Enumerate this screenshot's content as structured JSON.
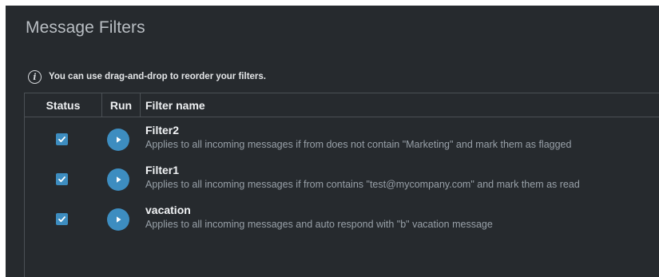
{
  "page": {
    "title": "Message Filters"
  },
  "notice": {
    "text": "You can use drag-and-drop to reorder your filters."
  },
  "table": {
    "columns": {
      "status": "Status",
      "run": "Run",
      "name": "Filter name"
    },
    "rows": [
      {
        "name": "Filter2",
        "description": "Applies to all incoming messages if from does not contain \"Marketing\" and mark them as flagged",
        "enabled": true
      },
      {
        "name": "Filter1",
        "description": "Applies to all incoming messages if from contains \"test@mycompany.com\" and mark them as read",
        "enabled": true
      },
      {
        "name": "vacation",
        "description": "Applies to all incoming messages and auto respond with \"b\" vacation message",
        "enabled": true
      }
    ]
  },
  "colors": {
    "background": "#262a2e",
    "accent": "#3d8dc0",
    "border": "#4b5055"
  },
  "icons": {
    "notice": "info-icon",
    "status": "checkbox-checked-icon",
    "run": "play-icon"
  }
}
